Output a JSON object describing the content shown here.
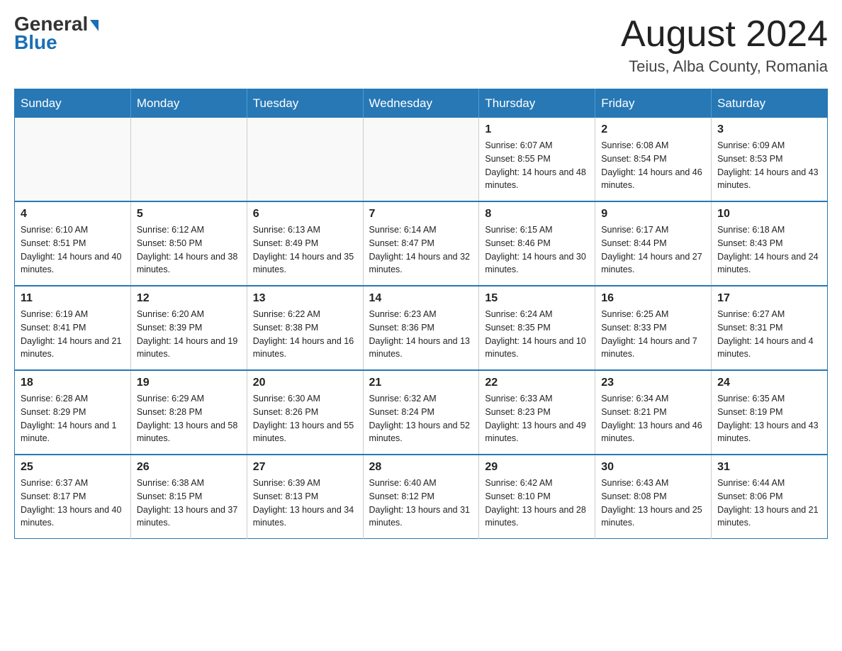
{
  "logo": {
    "text1": "General",
    "text2": "Blue"
  },
  "title": {
    "month": "August 2024",
    "location": "Teius, Alba County, Romania"
  },
  "days_of_week": [
    "Sunday",
    "Monday",
    "Tuesday",
    "Wednesday",
    "Thursday",
    "Friday",
    "Saturday"
  ],
  "weeks": [
    [
      {
        "day": "",
        "info": ""
      },
      {
        "day": "",
        "info": ""
      },
      {
        "day": "",
        "info": ""
      },
      {
        "day": "",
        "info": ""
      },
      {
        "day": "1",
        "info": "Sunrise: 6:07 AM\nSunset: 8:55 PM\nDaylight: 14 hours and 48 minutes."
      },
      {
        "day": "2",
        "info": "Sunrise: 6:08 AM\nSunset: 8:54 PM\nDaylight: 14 hours and 46 minutes."
      },
      {
        "day": "3",
        "info": "Sunrise: 6:09 AM\nSunset: 8:53 PM\nDaylight: 14 hours and 43 minutes."
      }
    ],
    [
      {
        "day": "4",
        "info": "Sunrise: 6:10 AM\nSunset: 8:51 PM\nDaylight: 14 hours and 40 minutes."
      },
      {
        "day": "5",
        "info": "Sunrise: 6:12 AM\nSunset: 8:50 PM\nDaylight: 14 hours and 38 minutes."
      },
      {
        "day": "6",
        "info": "Sunrise: 6:13 AM\nSunset: 8:49 PM\nDaylight: 14 hours and 35 minutes."
      },
      {
        "day": "7",
        "info": "Sunrise: 6:14 AM\nSunset: 8:47 PM\nDaylight: 14 hours and 32 minutes."
      },
      {
        "day": "8",
        "info": "Sunrise: 6:15 AM\nSunset: 8:46 PM\nDaylight: 14 hours and 30 minutes."
      },
      {
        "day": "9",
        "info": "Sunrise: 6:17 AM\nSunset: 8:44 PM\nDaylight: 14 hours and 27 minutes."
      },
      {
        "day": "10",
        "info": "Sunrise: 6:18 AM\nSunset: 8:43 PM\nDaylight: 14 hours and 24 minutes."
      }
    ],
    [
      {
        "day": "11",
        "info": "Sunrise: 6:19 AM\nSunset: 8:41 PM\nDaylight: 14 hours and 21 minutes."
      },
      {
        "day": "12",
        "info": "Sunrise: 6:20 AM\nSunset: 8:39 PM\nDaylight: 14 hours and 19 minutes."
      },
      {
        "day": "13",
        "info": "Sunrise: 6:22 AM\nSunset: 8:38 PM\nDaylight: 14 hours and 16 minutes."
      },
      {
        "day": "14",
        "info": "Sunrise: 6:23 AM\nSunset: 8:36 PM\nDaylight: 14 hours and 13 minutes."
      },
      {
        "day": "15",
        "info": "Sunrise: 6:24 AM\nSunset: 8:35 PM\nDaylight: 14 hours and 10 minutes."
      },
      {
        "day": "16",
        "info": "Sunrise: 6:25 AM\nSunset: 8:33 PM\nDaylight: 14 hours and 7 minutes."
      },
      {
        "day": "17",
        "info": "Sunrise: 6:27 AM\nSunset: 8:31 PM\nDaylight: 14 hours and 4 minutes."
      }
    ],
    [
      {
        "day": "18",
        "info": "Sunrise: 6:28 AM\nSunset: 8:29 PM\nDaylight: 14 hours and 1 minute."
      },
      {
        "day": "19",
        "info": "Sunrise: 6:29 AM\nSunset: 8:28 PM\nDaylight: 13 hours and 58 minutes."
      },
      {
        "day": "20",
        "info": "Sunrise: 6:30 AM\nSunset: 8:26 PM\nDaylight: 13 hours and 55 minutes."
      },
      {
        "day": "21",
        "info": "Sunrise: 6:32 AM\nSunset: 8:24 PM\nDaylight: 13 hours and 52 minutes."
      },
      {
        "day": "22",
        "info": "Sunrise: 6:33 AM\nSunset: 8:23 PM\nDaylight: 13 hours and 49 minutes."
      },
      {
        "day": "23",
        "info": "Sunrise: 6:34 AM\nSunset: 8:21 PM\nDaylight: 13 hours and 46 minutes."
      },
      {
        "day": "24",
        "info": "Sunrise: 6:35 AM\nSunset: 8:19 PM\nDaylight: 13 hours and 43 minutes."
      }
    ],
    [
      {
        "day": "25",
        "info": "Sunrise: 6:37 AM\nSunset: 8:17 PM\nDaylight: 13 hours and 40 minutes."
      },
      {
        "day": "26",
        "info": "Sunrise: 6:38 AM\nSunset: 8:15 PM\nDaylight: 13 hours and 37 minutes."
      },
      {
        "day": "27",
        "info": "Sunrise: 6:39 AM\nSunset: 8:13 PM\nDaylight: 13 hours and 34 minutes."
      },
      {
        "day": "28",
        "info": "Sunrise: 6:40 AM\nSunset: 8:12 PM\nDaylight: 13 hours and 31 minutes."
      },
      {
        "day": "29",
        "info": "Sunrise: 6:42 AM\nSunset: 8:10 PM\nDaylight: 13 hours and 28 minutes."
      },
      {
        "day": "30",
        "info": "Sunrise: 6:43 AM\nSunset: 8:08 PM\nDaylight: 13 hours and 25 minutes."
      },
      {
        "day": "31",
        "info": "Sunrise: 6:44 AM\nSunset: 8:06 PM\nDaylight: 13 hours and 21 minutes."
      }
    ]
  ]
}
